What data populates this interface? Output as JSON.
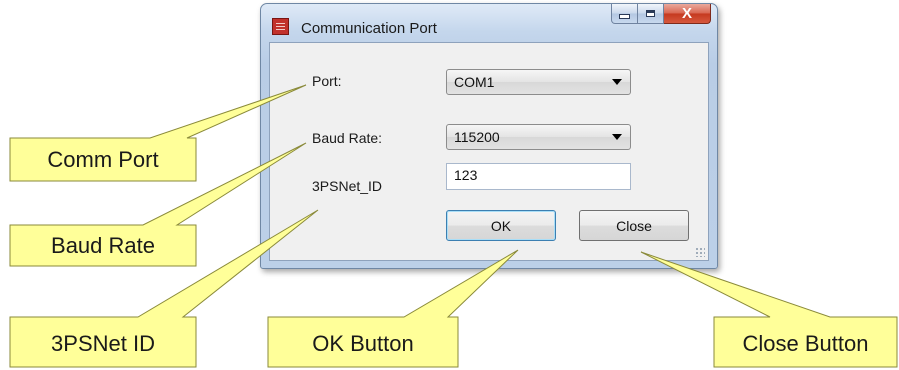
{
  "window": {
    "title": "Communication Port",
    "caption_buttons": {
      "close_label": "X"
    }
  },
  "form": {
    "port_label": "Port:",
    "port_value": "COM1",
    "baud_label": "Baud Rate:",
    "baud_value": "115200",
    "netid_label": "3PSNet_ID",
    "netid_value": "123",
    "ok_label": "OK",
    "close_label": "Close"
  },
  "callouts": {
    "comm_port": "Comm Port",
    "baud_rate": "Baud Rate",
    "netid": "3PSNet ID",
    "ok_button": "OK Button",
    "close_button": "Close Button"
  },
  "colors": {
    "callout_fill": "#ffff99",
    "window_frame": "#c4d6ec",
    "close_button": "#c5391f"
  }
}
